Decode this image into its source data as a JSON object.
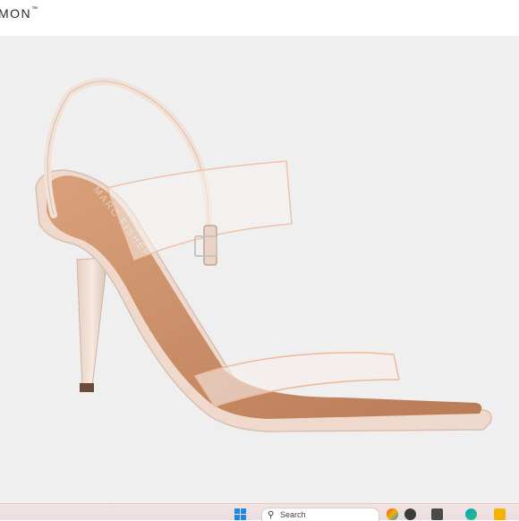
{
  "header": {
    "brand_partial": "MON",
    "brand_mark": "™"
  },
  "product_image": {
    "subject": "clear strap square-toe stiletto sandal",
    "insole_logo_text": "MARC FISHER"
  },
  "taskbar": {
    "search_text": "Search",
    "icons": [
      "windows-start-icon",
      "search-icon",
      "browser-icon",
      "dark-app-icon",
      "task-view-icon",
      "edge-icon",
      "folder-icon"
    ]
  },
  "colors": {
    "photo_background": "#efefef",
    "insole": "#c48a63",
    "sole": "#efd9cd",
    "strap": "#f3e3d8"
  }
}
